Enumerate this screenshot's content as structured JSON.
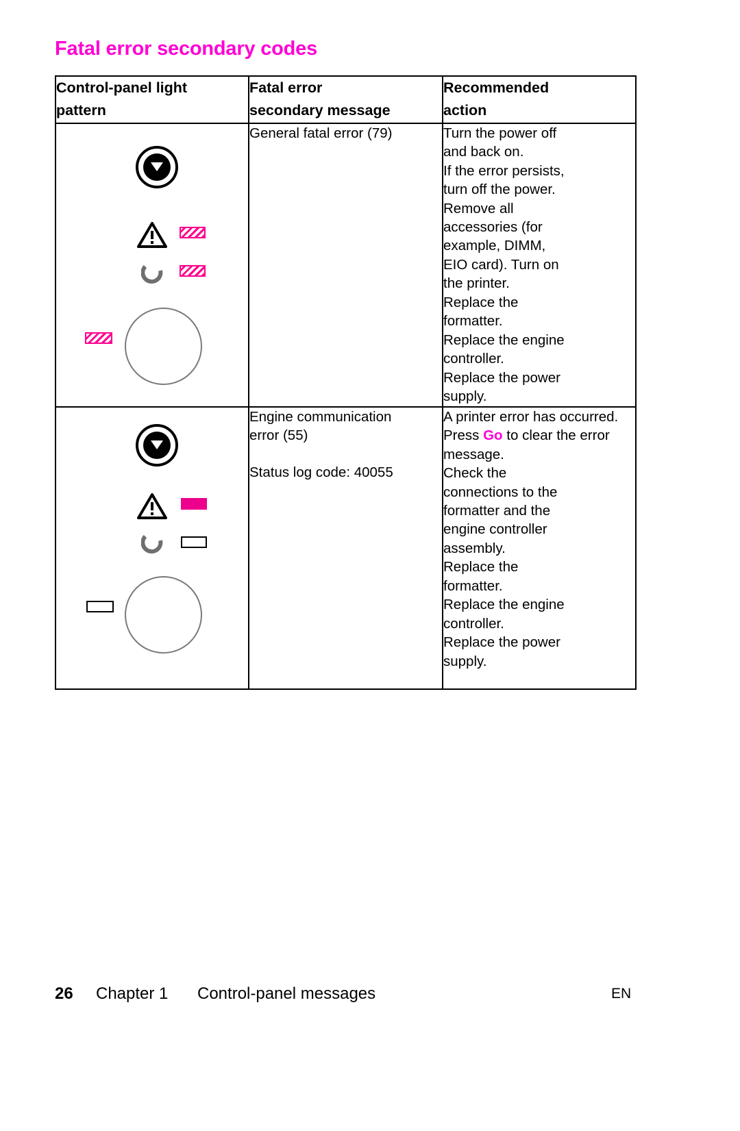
{
  "document": {
    "title": "Fatal error secondary codes",
    "title_color": "#ff00d4"
  },
  "table": {
    "headers": [
      {
        "line1": "Control-panel light",
        "line2": "pattern"
      },
      {
        "line1": "Fatal error",
        "line2": "secondary message"
      },
      {
        "line1": "Recommended",
        "line2": "action"
      }
    ],
    "rows": [
      {
        "lights": {
          "go_button": "go-button-icon",
          "attention_led": "hatched-magenta",
          "ready_led": "hatched-magenta",
          "data_led": "hatched-magenta",
          "led_color": "#ff0090"
        },
        "message_lines": [
          "General fatal error (79)"
        ],
        "action_lines": [
          "Turn the power off",
          "and back on.",
          "If the error persists,",
          "turn off the power.",
          "Remove all",
          "accessories (for",
          "example, DIMM,",
          "EIO card). Turn on",
          "the printer.",
          "Replace the",
          "formatter.",
          "Replace the engine",
          "controller.",
          "Replace the power",
          "supply."
        ]
      },
      {
        "lights": {
          "go_button": "go-button-icon",
          "attention_led": "solid-magenta",
          "ready_led": "empty-outline",
          "data_led": "empty-outline",
          "led_color": "#ec008c"
        },
        "message_lines": [
          "Engine communication",
          "error (55)"
        ],
        "message_extra": "Status log code: 40055",
        "action_before_go": "A printer error has occurred. Press ",
        "action_go_label": "Go",
        "action_after_go": " to clear the error message.",
        "action_lines": [
          "Check the",
          "connections to the",
          "formatter and the",
          "engine controller",
          "assembly.",
          "Replace the",
          "formatter.",
          "Replace the engine",
          "controller.",
          "Replace the power",
          "supply."
        ]
      }
    ]
  },
  "footer": {
    "page_number": "26",
    "chapter": "Chapter 1",
    "section": "Control-panel messages",
    "language": "EN"
  }
}
